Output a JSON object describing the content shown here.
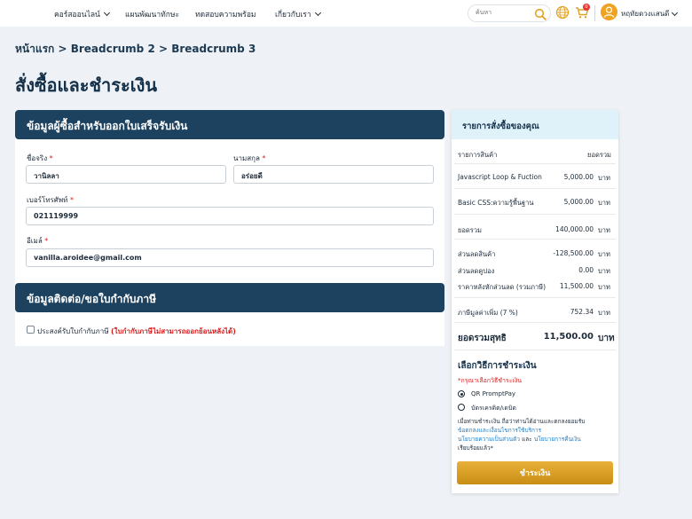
{
  "nav": {
    "items": [
      {
        "label": "คอร์สออนไลน์",
        "has_dropdown": true
      },
      {
        "label": "แผนพัฒนาทักษะ",
        "has_dropdown": false
      },
      {
        "label": "ทดสอบความพร้อม",
        "has_dropdown": false
      },
      {
        "label": "เกี่ยวกับเรา",
        "has_dropdown": true
      }
    ],
    "search_placeholder": "ค้นหา",
    "cart_badge": "0",
    "user_name": "หฤทัยดวงแสนดี"
  },
  "breadcrumb": "หน้าแรก > Breadcrumb 2 > Breadcrumb 3",
  "page_title": "สั่งซื้อและชำระเงิน",
  "billing": {
    "title": "ข้อมูลผู้ซื้อสำหรับออกใบเสร็จรับเงิน",
    "first_name_label": "ชื่อจริง",
    "first_name_value": "วานิลลา",
    "last_name_label": "นามสกุล",
    "last_name_value": "อร่อยดี",
    "phone_label": "เบอร์โทรศัพท์",
    "phone_value": "021119999",
    "email_label": "อีเมล์",
    "email_value": "vanilla.aroidee@gmail.com",
    "required_mark": "*"
  },
  "tax": {
    "title": "ข้อมูลติดต่อ/ขอใบกำกับภาษี",
    "checkbox_label": "ประสงค์รับใบกำกับภาษี",
    "checkbox_warning": "(ใบกำกับภาษีไม่สามารถออกย้อนหลังได้)",
    "checked": false
  },
  "summary": {
    "title": "รายการสั่งซื้อของคุณ",
    "col_item": "รายการสินค้า",
    "col_total": "ยอดรวม",
    "unit": "บาท",
    "items": [
      {
        "name": "Javascript Loop & Fuction",
        "amount": "5,000.00"
      },
      {
        "name": "Basic CSS:ความรู้พื้นฐาน",
        "amount": "5,000.00"
      }
    ],
    "subtotal_label": "ยอดรวม",
    "subtotal": "140,000.00",
    "product_discount_label": "ส่วนลดสินค้า",
    "product_discount": "-128,500.00",
    "coupon_discount_label": "ส่วนลดคูปอง",
    "coupon_discount": "0.00",
    "after_discount_label": "ราคาหลังหักส่วนลด (รวมภาษี)",
    "after_discount": "11,500.00",
    "vat_label": "ภาษีมูลค่าเพิ่ม (7 %)",
    "vat": "752.34",
    "net_label": "ยอดรวมสุทธิ",
    "net": "11,500.00"
  },
  "payment": {
    "title": "เลือกวิธีการชำระเงิน",
    "hint": "*กรุณาเลือกวิธีชำระเงิน",
    "options": [
      {
        "label": "QR PromptPay",
        "selected": true
      },
      {
        "label": "บัตรเครดิต/เดบิต",
        "selected": false
      }
    ],
    "terms_prefix": "เมื่อท่านชำระเงิน ถือว่าท่านได้อ่านและตกลงยอมรับ",
    "terms_link1": "ข้อตกลงและเงื่อนไขการใช้บริการ",
    "terms_link2": "นโยบายความเป็นส่วนตัว",
    "terms_and": "และ",
    "terms_link3": "นโยบายการคืนเงิน",
    "terms_suffix": "เรียบร้อยแล้ว*",
    "button_label": "ชำระเงิน"
  },
  "colors": {
    "header_bg": "#1c4260",
    "summary_head_bg": "#dff2f9",
    "accent": "#d9a02a",
    "required": "#d91d1d",
    "link": "#1f7fc8"
  }
}
